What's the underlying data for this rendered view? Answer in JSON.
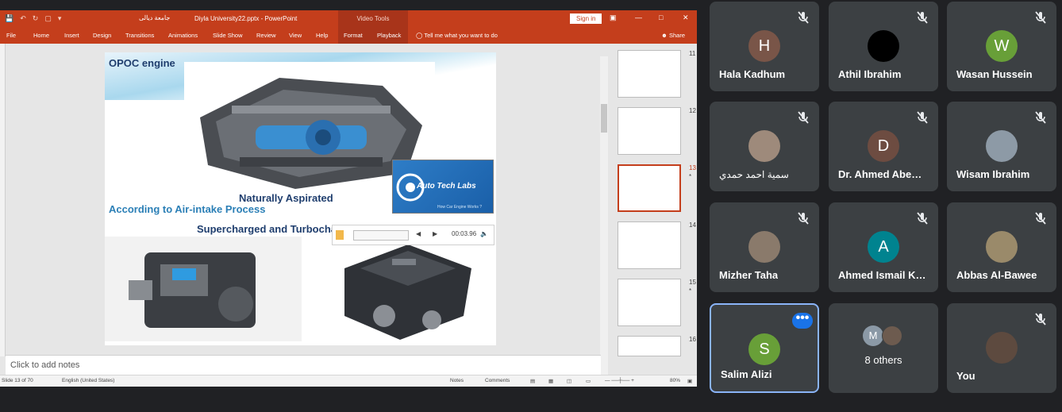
{
  "ppt": {
    "quick_access_arabic": "جامعة ديالى",
    "title": "Diyla University22.pptx - PowerPoint",
    "context_tab": "Video Tools",
    "sign_in": "Sign in",
    "tabs": [
      "File",
      "Home",
      "Insert",
      "Design",
      "Transitions",
      "Animations",
      "Slide Show",
      "Review",
      "View",
      "Help",
      "Format",
      "Playback"
    ],
    "tell_me": "Tell me what you want to do",
    "share": "Share",
    "notes_placeholder": "Click to add notes",
    "status": {
      "slide": "Slide 13 of 70",
      "language": "English (United States)",
      "notes": "Notes",
      "comments": "Comments",
      "zoom": "80%"
    },
    "slide": {
      "title": "OPOC engine",
      "naturally": "Naturally Aspirated",
      "according": "According to Air-intake Process",
      "supercharged": "Supercharged and Turbocharged",
      "logo_text": "Auto Tech Labs",
      "logo_sub": "How Car Engine Works ?",
      "media_time": "00:03.96"
    },
    "thumbnails": [
      {
        "num": "11",
        "star": ""
      },
      {
        "num": "12",
        "star": ""
      },
      {
        "num": "13",
        "star": "*"
      },
      {
        "num": "14",
        "star": ""
      },
      {
        "num": "15",
        "star": "*"
      },
      {
        "num": "16",
        "star": ""
      }
    ]
  },
  "meet": {
    "participants": [
      {
        "name": "Hala Kadhum",
        "initial": "H",
        "color": "#795548"
      },
      {
        "name": "Athil Ibrahim",
        "initial": "",
        "color": "#000000"
      },
      {
        "name": "Wasan Hussein",
        "initial": "W",
        "color": "#689f38"
      },
      {
        "name": "سمية احمد حمدي",
        "initial": "",
        "color": "#9e8a7b"
      },
      {
        "name": "Dr. Ahmed Abe…",
        "initial": "D",
        "color": "#6d4c41"
      },
      {
        "name": "Wisam Ibrahim",
        "initial": "",
        "color": "#8d9aa6"
      },
      {
        "name": "Mizher Taha",
        "initial": "",
        "color": "#8a7a6b"
      },
      {
        "name": "Ahmed Ismail K…",
        "initial": "A",
        "color": "#00838f"
      },
      {
        "name": "Abbas Al-Bawee",
        "initial": "",
        "color": "#9a8a6a"
      },
      {
        "name": "Salim Alizi",
        "initial": "S",
        "color": "#689f38"
      },
      {
        "name": "8 others",
        "initial": "M",
        "color": "#8b99a6"
      },
      {
        "name": "You",
        "initial": "",
        "color": "#5d4a3f"
      }
    ],
    "more_options": "•••"
  }
}
